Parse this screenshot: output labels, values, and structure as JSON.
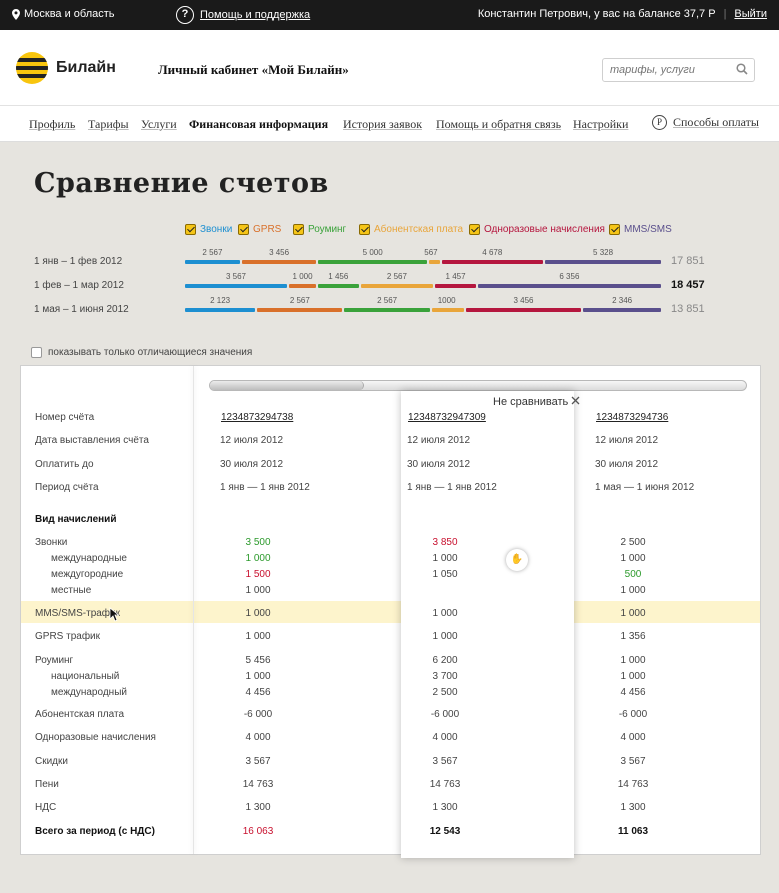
{
  "topbar": {
    "region": "Москва и область",
    "help": "Помощь и поддержка",
    "user_info": "Константин Петрович, у вас на балансе 37,7 Р",
    "separator": "|",
    "logout": "Выйти"
  },
  "header": {
    "logo_text": "Билайн",
    "cabinet_title": "Личный кабинет «Мой Билайн»",
    "search_placeholder": "тарифы, услуги"
  },
  "nav": {
    "items": [
      "Профиль",
      "Тарифы",
      "Услуги",
      "Финансовая информация",
      "История заявок",
      "Помощь и обратня связь",
      "Настройки"
    ],
    "active_index": 3,
    "pay_label": "Способы оплаты",
    "pay_icon": "Р"
  },
  "page_title": "Сравнение счетов",
  "legend": [
    {
      "label": "Звонки",
      "color": "#1d8fd1"
    },
    {
      "label": "GPRS",
      "color": "#d9702a"
    },
    {
      "label": "Роуминг",
      "color": "#3aa23a"
    },
    {
      "label": "Абонентская плата",
      "color": "#e9a53a"
    },
    {
      "label": "Одноразовые начисления",
      "color": "#b5163e"
    },
    {
      "label": "MMS/SMS",
      "color": "#5a4f8c"
    }
  ],
  "periods": [
    {
      "period": "1 янв – 1 фев 2012",
      "total": "17 851",
      "bold": false,
      "labels": [
        "2 567",
        "3 456",
        "5 000",
        "567",
        "4 678",
        "5 328"
      ]
    },
    {
      "period": "1 фев – 1 мар 2012",
      "total": "18 457",
      "bold": true,
      "labels": [
        "3 567",
        "1 000",
        "1 456",
        "2 567",
        "1 457",
        "6 356"
      ]
    },
    {
      "period": "1 мая – 1 июня 2012",
      "total": "13 851",
      "bold": false,
      "labels": [
        "2 123",
        "2 567",
        "2 567",
        "1000",
        "3 456",
        "2 346"
      ]
    }
  ],
  "only_diff_label": "показывать только отличающиеся значения",
  "no_compare_label": "Не сравнивать",
  "table": {
    "accounts": [
      "1234873294738",
      "12348732947309",
      "1234873294736"
    ],
    "rows": [
      {
        "label": "Номер счёта",
        "type": "account"
      },
      {
        "label": "Дата выставления счёта",
        "values": [
          "12 июля 2012",
          "12 июля 2012",
          "12 июля 2012"
        ],
        "type": "text"
      },
      {
        "label": "Оплатить до",
        "values": [
          "30 июля 2012",
          "30 июля 2012",
          "30 июля 2012"
        ],
        "type": "text"
      },
      {
        "label": "Период счёта",
        "values": [
          "1 янв — 1 янв 2012",
          "1 янв — 1 янв 2012",
          "1 мая — 1 июня 2012"
        ],
        "type": "text"
      },
      {
        "label": "Вид начислений",
        "type": "header"
      },
      {
        "label": "Звонки",
        "values": [
          "3 500",
          "3 850",
          "2 500"
        ],
        "colors": [
          "green",
          "red",
          ""
        ]
      },
      {
        "label": "международные",
        "values": [
          "1 000",
          "1 000",
          "1 000"
        ],
        "colors": [
          "green",
          "",
          ""
        ],
        "sub": true
      },
      {
        "label": "междугородние",
        "values": [
          "1 500",
          "1 050",
          "500"
        ],
        "colors": [
          "red",
          "",
          "green"
        ],
        "sub": true
      },
      {
        "label": "местные",
        "values": [
          "1 000",
          "",
          "1 000"
        ],
        "colors": [
          "",
          "",
          ""
        ],
        "sub": true
      },
      {
        "label": "MMS/SMS-трафик",
        "values": [
          "1 000",
          "1 000",
          "1 000"
        ],
        "colors": [
          "",
          "",
          ""
        ]
      },
      {
        "label": "GPRS трафик",
        "values": [
          "1 000",
          "1 000",
          "1 356"
        ],
        "colors": [
          "",
          "",
          ""
        ]
      },
      {
        "label": "Роуминг",
        "values": [
          "5 456",
          "6 200",
          "1 000"
        ],
        "colors": [
          "",
          "",
          ""
        ]
      },
      {
        "label": "национальный",
        "values": [
          "1 000",
          "3 700",
          "1 000"
        ],
        "colors": [
          "",
          "",
          ""
        ],
        "sub": true
      },
      {
        "label": "международный",
        "values": [
          "4 456",
          "2 500",
          "4 456"
        ],
        "colors": [
          "",
          "",
          ""
        ],
        "sub": true
      },
      {
        "label": "Абонентская плата",
        "values": [
          "-6 000",
          "-6 000",
          "-6 000"
        ],
        "colors": [
          "",
          "",
          ""
        ]
      },
      {
        "label": "Одноразовые начисления",
        "values": [
          "4 000",
          "4 000",
          "4 000"
        ],
        "colors": [
          "",
          "",
          ""
        ]
      },
      {
        "label": "Скидки",
        "values": [
          "3 567",
          "3 567",
          "3 567"
        ],
        "colors": [
          "",
          "",
          ""
        ]
      },
      {
        "label": "Пени",
        "values": [
          "14 763",
          "14 763",
          "14 763"
        ],
        "colors": [
          "",
          "",
          ""
        ]
      },
      {
        "label": "НДС",
        "values": [
          "1 300",
          "1 300",
          "1 300"
        ],
        "colors": [
          "",
          "",
          ""
        ]
      },
      {
        "label": "Всего за период (с НДС)",
        "values": [
          "16 063",
          "12 543",
          "11 063"
        ],
        "colors": [
          "red",
          "blk",
          "blk"
        ],
        "bold": true
      }
    ]
  },
  "icons": {
    "pin": "location-pin-icon",
    "help": "question-icon",
    "search": "search-icon",
    "close": "close-icon",
    "cursor": "mouse-pointer-icon",
    "grab": "grab-hand-icon"
  }
}
